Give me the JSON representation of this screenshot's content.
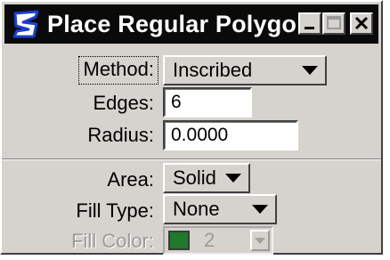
{
  "window": {
    "title": "Place Regular Polygon",
    "icon": "microstation-logo-icon",
    "colors": {
      "titlebar": "#0a0a0a",
      "face": "#d6d3ce",
      "swatch": "#1f7a2b"
    }
  },
  "fields": {
    "method": {
      "label": "Method:",
      "value": "Inscribed"
    },
    "edges": {
      "label": "Edges:",
      "value": "6"
    },
    "radius": {
      "label": "Radius:",
      "value": "0.0000"
    },
    "area": {
      "label": "Area:",
      "value": "Solid"
    },
    "fill_type": {
      "label": "Fill Type:",
      "value": "None"
    },
    "fill_color": {
      "label": "Fill Color:",
      "value": "2"
    }
  }
}
